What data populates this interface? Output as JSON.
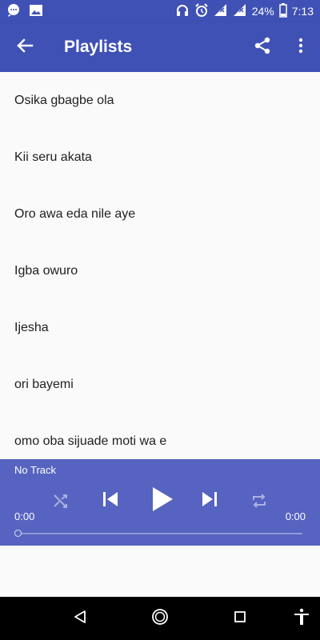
{
  "status_bar": {
    "battery_text": "24%",
    "time": "7:13",
    "icons": [
      "chat-bubble-icon",
      "image-icon",
      "headphones-icon",
      "alarm-icon",
      "signal-icon",
      "signal-icon",
      "battery-icon"
    ]
  },
  "app_bar": {
    "title": "Playlists",
    "icons": [
      "back-arrow-icon",
      "share-icon",
      "more-vert-icon"
    ]
  },
  "playlist": {
    "items": [
      "Osika gbagbe ola",
      "Kii seru akata",
      "Oro awa eda nile aye",
      "Igba owuro",
      "Ijesha",
      "ori bayemi",
      "omo oba sijuade moti wa e"
    ]
  },
  "player": {
    "track_title": "No Track",
    "elapsed": "0:00",
    "duration": "0:00",
    "progress": 0,
    "icons": [
      "shuffle-icon",
      "skip-previous-icon",
      "play-icon",
      "skip-next-icon",
      "repeat-icon"
    ]
  },
  "nav_bar": {
    "icons": [
      "nav-back-icon",
      "nav-home-icon",
      "nav-recents-icon",
      "accessibility-icon"
    ]
  },
  "colors": {
    "primary": "#3f51b5",
    "player_bg": "#5663c0",
    "list_bg": "#fafafa",
    "text": "#212121"
  }
}
